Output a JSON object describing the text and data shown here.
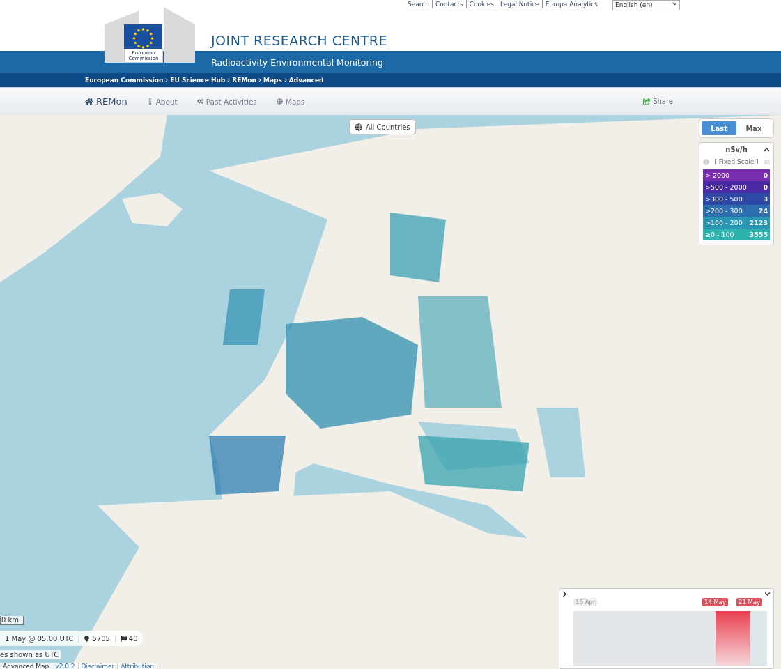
{
  "top_links": [
    "Search",
    "Contacts",
    "Cookies",
    "Legal Notice",
    "Europa Analytics"
  ],
  "language": {
    "value": "English (en)"
  },
  "logo": {
    "caption": "European Commission"
  },
  "site_title": "JOINT RESEARCH CENTRE",
  "subtitle": "Radioactivity Environmental Monitoring",
  "breadcrumb": [
    "European Commission",
    "EU Science Hub",
    "REMon",
    "Maps",
    "Advanced"
  ],
  "nav": [
    {
      "label": "REMon"
    },
    {
      "label": "About"
    },
    {
      "label": "Past Activities"
    },
    {
      "label": "Maps"
    }
  ],
  "share": "Share",
  "map": {
    "country_button": "All Countries",
    "mode_tabs": [
      {
        "label": "Last",
        "selected": true
      },
      {
        "label": "Max",
        "selected": false
      }
    ],
    "legend": {
      "unit": "nSv/h",
      "scale": "[ Fixed Scale ]",
      "expanded": true,
      "items": [
        {
          "range": "> 2000",
          "count": "0",
          "color": "#7a2fb0"
        },
        {
          "range": ">500 - 2000",
          "count": "0",
          "color": "#4b2aa6"
        },
        {
          "range": ">300 - 500",
          "count": "3",
          "color": "#2f4aa6"
        },
        {
          "range": ">200 - 300",
          "count": "24",
          "color": "#2f6fb0"
        },
        {
          "range": ">100 - 200",
          "count": "2123",
          "color": "#2b96b4"
        },
        {
          "range": "≥0 - 100",
          "count": "3555",
          "color": "#2eb2ad"
        }
      ]
    },
    "scale": "0 km",
    "status": {
      "time": "1 May @ 05:00 UTC",
      "stations": "5705",
      "countries": "40"
    },
    "tz_note": "es shown as UTC",
    "footer_links": [
      "Advanced Map",
      "v2.0.2",
      "Disclaimer",
      "Attribution"
    ],
    "timeline": {
      "start": "16 Apr",
      "range_start": "14 May",
      "range_end": "21 May",
      "expanded": true
    }
  }
}
